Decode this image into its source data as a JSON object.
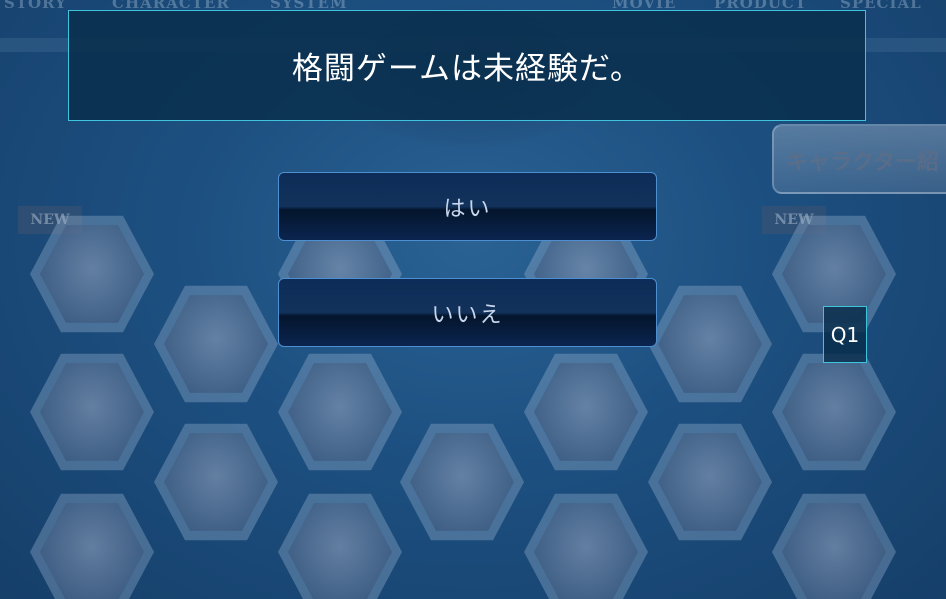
{
  "background": {
    "nav_items": [
      "STORY",
      "CHARACTER",
      "SYSTEM",
      "MOVIE",
      "PRODUCT",
      "SPECIAL"
    ],
    "banner_text": "キャラクター紹",
    "new_badges": [
      "NEW",
      "NEW"
    ]
  },
  "quiz": {
    "question": "格闘ゲームは未経験だ。",
    "answers": [
      {
        "label": "はい"
      },
      {
        "label": "いいえ"
      }
    ],
    "question_number": "Q1"
  },
  "colors": {
    "accent_border": "#3fc4de",
    "button_border": "#4d8fd0",
    "background": "#1c4f80"
  }
}
